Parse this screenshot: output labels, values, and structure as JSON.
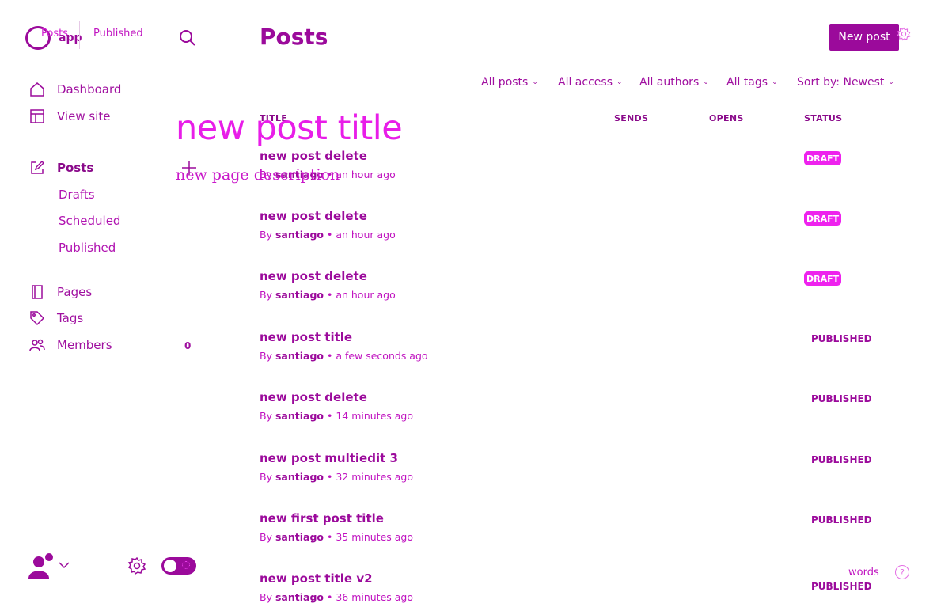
{
  "brand": {
    "name": "app",
    "crumb_posts": "Posts",
    "crumb_published": "Published"
  },
  "sidebar": {
    "items": [
      {
        "label": "Dashboard",
        "icon": "home-icon"
      },
      {
        "label": "View site",
        "icon": "layout-icon"
      },
      {
        "label": "Posts",
        "icon": "pencil-edit-icon"
      },
      {
        "label": "Pages",
        "icon": "page-icon"
      },
      {
        "label": "Tags",
        "icon": "tag-icon"
      },
      {
        "label": "Members",
        "icon": "members-icon"
      }
    ],
    "posts_sub": [
      "Drafts",
      "Scheduled",
      "Published"
    ],
    "members_count": "0"
  },
  "overlay": {
    "title": "new post title",
    "description": "new page description"
  },
  "main": {
    "title": "Posts",
    "new_post": "New post",
    "filters": [
      "All posts",
      "All access",
      "All authors",
      "All tags",
      "Sort by: Newest"
    ],
    "columns": {
      "title": "TITLE",
      "sends": "SENDS",
      "opens": "OPENS",
      "status": "STATUS"
    },
    "rows": [
      {
        "title": "new post delete",
        "by": "By",
        "author": "santiago",
        "time": "an hour ago",
        "status": "DRAFT"
      },
      {
        "title": "new post delete",
        "by": "By",
        "author": "santiago",
        "time": "an hour ago",
        "status": "DRAFT"
      },
      {
        "title": "new post delete",
        "by": "By",
        "author": "santiago",
        "time": "an hour ago",
        "status": "DRAFT"
      },
      {
        "title": "new post title",
        "by": "By",
        "author": "santiago",
        "time": "a few seconds ago",
        "status": "PUBLISHED"
      },
      {
        "title": "new post delete",
        "by": "By",
        "author": "santiago",
        "time": "14 minutes ago",
        "status": "PUBLISHED"
      },
      {
        "title": "new post multiedit 3",
        "by": "By",
        "author": "santiago",
        "time": "32 minutes ago",
        "status": "PUBLISHED"
      },
      {
        "title": "new first post title",
        "by": "By",
        "author": "santiago",
        "time": "35 minutes ago",
        "status": "PUBLISHED"
      },
      {
        "title": "new post title v2",
        "by": "By",
        "author": "santiago",
        "time": "36 minutes ago",
        "status": "PUBLISHED"
      }
    ]
  },
  "footer": {
    "words": "words",
    "help": "?"
  },
  "colors": {
    "accent": "#9b0a9b",
    "draft_badge": "#ee22ee",
    "ghost_text": "#e81de8"
  }
}
